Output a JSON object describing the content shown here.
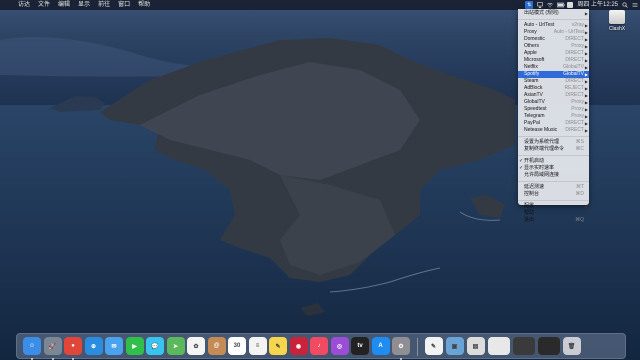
{
  "menubar": {
    "apple": "",
    "items": [
      "访达",
      "文件",
      "编辑",
      "显示",
      "前往",
      "窗口",
      "帮助"
    ],
    "status_icon_label": "ClashX",
    "clock": "周四 上午12:25"
  },
  "desktop": {
    "drive_label": "ClashX"
  },
  "clash_menu": {
    "rows": [
      {
        "type": "item",
        "label": "出站模式 (规则)",
        "right": "",
        "arrow": true
      },
      {
        "type": "sep"
      },
      {
        "type": "item",
        "label": "Auto - UrlTest",
        "right": "v2ray",
        "arrow": true
      },
      {
        "type": "item",
        "label": "Proxy",
        "right": "Auto - UrlTest",
        "arrow": true
      },
      {
        "type": "item",
        "label": "Domestic",
        "right": "DIRECT",
        "arrow": true
      },
      {
        "type": "item",
        "label": "Others",
        "right": "Proxy",
        "arrow": true
      },
      {
        "type": "item",
        "label": "Apple",
        "right": "DIRECT",
        "arrow": true
      },
      {
        "type": "item",
        "label": "Microsoft",
        "right": "DIRECT",
        "arrow": true
      },
      {
        "type": "item",
        "label": "Netflix",
        "right": "GlobalTV",
        "arrow": true
      },
      {
        "type": "item",
        "label": "Spotify",
        "right": "GlobalTV",
        "arrow": true,
        "selected": true
      },
      {
        "type": "item",
        "label": "Steam",
        "right": "DIRECT",
        "arrow": true
      },
      {
        "type": "item",
        "label": "AdBlock",
        "right": "REJECT",
        "arrow": true
      },
      {
        "type": "item",
        "label": "AsianTV",
        "right": "DIRECT",
        "arrow": true
      },
      {
        "type": "item",
        "label": "GlobalTV",
        "right": "Proxy",
        "arrow": true
      },
      {
        "type": "item",
        "label": "Speedtest",
        "right": "Proxy",
        "arrow": true
      },
      {
        "type": "item",
        "label": "Telegram",
        "right": "Proxy",
        "arrow": true
      },
      {
        "type": "item",
        "label": "PayPal",
        "right": "DIRECT",
        "arrow": true
      },
      {
        "type": "item",
        "label": "Netease Music",
        "right": "DIRECT",
        "arrow": true
      },
      {
        "type": "sep"
      },
      {
        "type": "item",
        "label": "设置为系统代理",
        "right": "⌘S",
        "arrow": false
      },
      {
        "type": "item",
        "label": "复制终端代理命令",
        "right": "⌘C",
        "arrow": false
      },
      {
        "type": "sep"
      },
      {
        "type": "item",
        "label": "开机启动",
        "right": "",
        "arrow": false,
        "check": "✓"
      },
      {
        "type": "item",
        "label": "显示实时速率",
        "right": "",
        "arrow": false,
        "check": "✓"
      },
      {
        "type": "item",
        "label": "允许局域网连接",
        "right": "",
        "arrow": false
      },
      {
        "type": "sep"
      },
      {
        "type": "item",
        "label": "延迟测速",
        "right": "⌘T",
        "arrow": false
      },
      {
        "type": "item",
        "label": "控制台",
        "right": "⌘D",
        "arrow": false
      },
      {
        "type": "sep"
      },
      {
        "type": "item",
        "label": "配置",
        "right": "",
        "arrow": true
      },
      {
        "type": "item",
        "label": "帮助",
        "right": "",
        "arrow": true
      },
      {
        "type": "item",
        "label": "退出",
        "right": "⌘Q",
        "arrow": false
      }
    ]
  },
  "dock": {
    "apps": [
      {
        "name": "finder",
        "color": "#3b8ee8",
        "glyph": "☺"
      },
      {
        "name": "launchpad",
        "color": "#7b8794",
        "glyph": "🚀"
      },
      {
        "name": "chrome",
        "color": "#e0463a",
        "glyph": "●"
      },
      {
        "name": "safari",
        "color": "#2a8de0",
        "glyph": "⊕"
      },
      {
        "name": "mail",
        "color": "#4aa3ee",
        "glyph": "✉"
      },
      {
        "name": "facetime",
        "color": "#2fbf4a",
        "glyph": "▶"
      },
      {
        "name": "messages",
        "color": "#37c5f0",
        "glyph": "💬"
      },
      {
        "name": "maps",
        "color": "#5cb85c",
        "glyph": "➤"
      },
      {
        "name": "photos",
        "color": "#f4f4f4",
        "glyph": "✿"
      },
      {
        "name": "contacts",
        "color": "#c58b55",
        "glyph": "@"
      },
      {
        "name": "calendar",
        "color": "#ffffff",
        "glyph": "30"
      },
      {
        "name": "reminders",
        "color": "#f3f3f3",
        "glyph": "≡"
      },
      {
        "name": "notes",
        "color": "#f7d54c",
        "glyph": "✎"
      },
      {
        "name": "photo-booth",
        "color": "#c8233a",
        "glyph": "◉"
      },
      {
        "name": "music",
        "color": "#f04b63",
        "glyph": "♪"
      },
      {
        "name": "podcasts",
        "color": "#9c4dd8",
        "glyph": "◎"
      },
      {
        "name": "apple-tv",
        "color": "#222222",
        "glyph": "tv"
      },
      {
        "name": "app-store",
        "color": "#1e8cf0",
        "glyph": "A"
      },
      {
        "name": "system-preferences",
        "color": "#8e8e93",
        "glyph": "⚙"
      }
    ],
    "right_apps": [
      {
        "name": "textedit",
        "color": "#f2f2f2",
        "glyph": "✎"
      },
      {
        "name": "preview",
        "color": "#6aa4d6",
        "glyph": "▣"
      },
      {
        "name": "download-stack",
        "color": "#dcdcdc",
        "glyph": "▤"
      },
      {
        "name": "window-thumb-1",
        "color": "#e8e8e8",
        "glyph": ""
      },
      {
        "name": "window-thumb-2",
        "color": "#3a3a3a",
        "glyph": ""
      },
      {
        "name": "window-thumb-3",
        "color": "#2a2a2a",
        "glyph": ""
      },
      {
        "name": "trash",
        "color": "#c9ccd2",
        "glyph": "🗑"
      }
    ]
  }
}
